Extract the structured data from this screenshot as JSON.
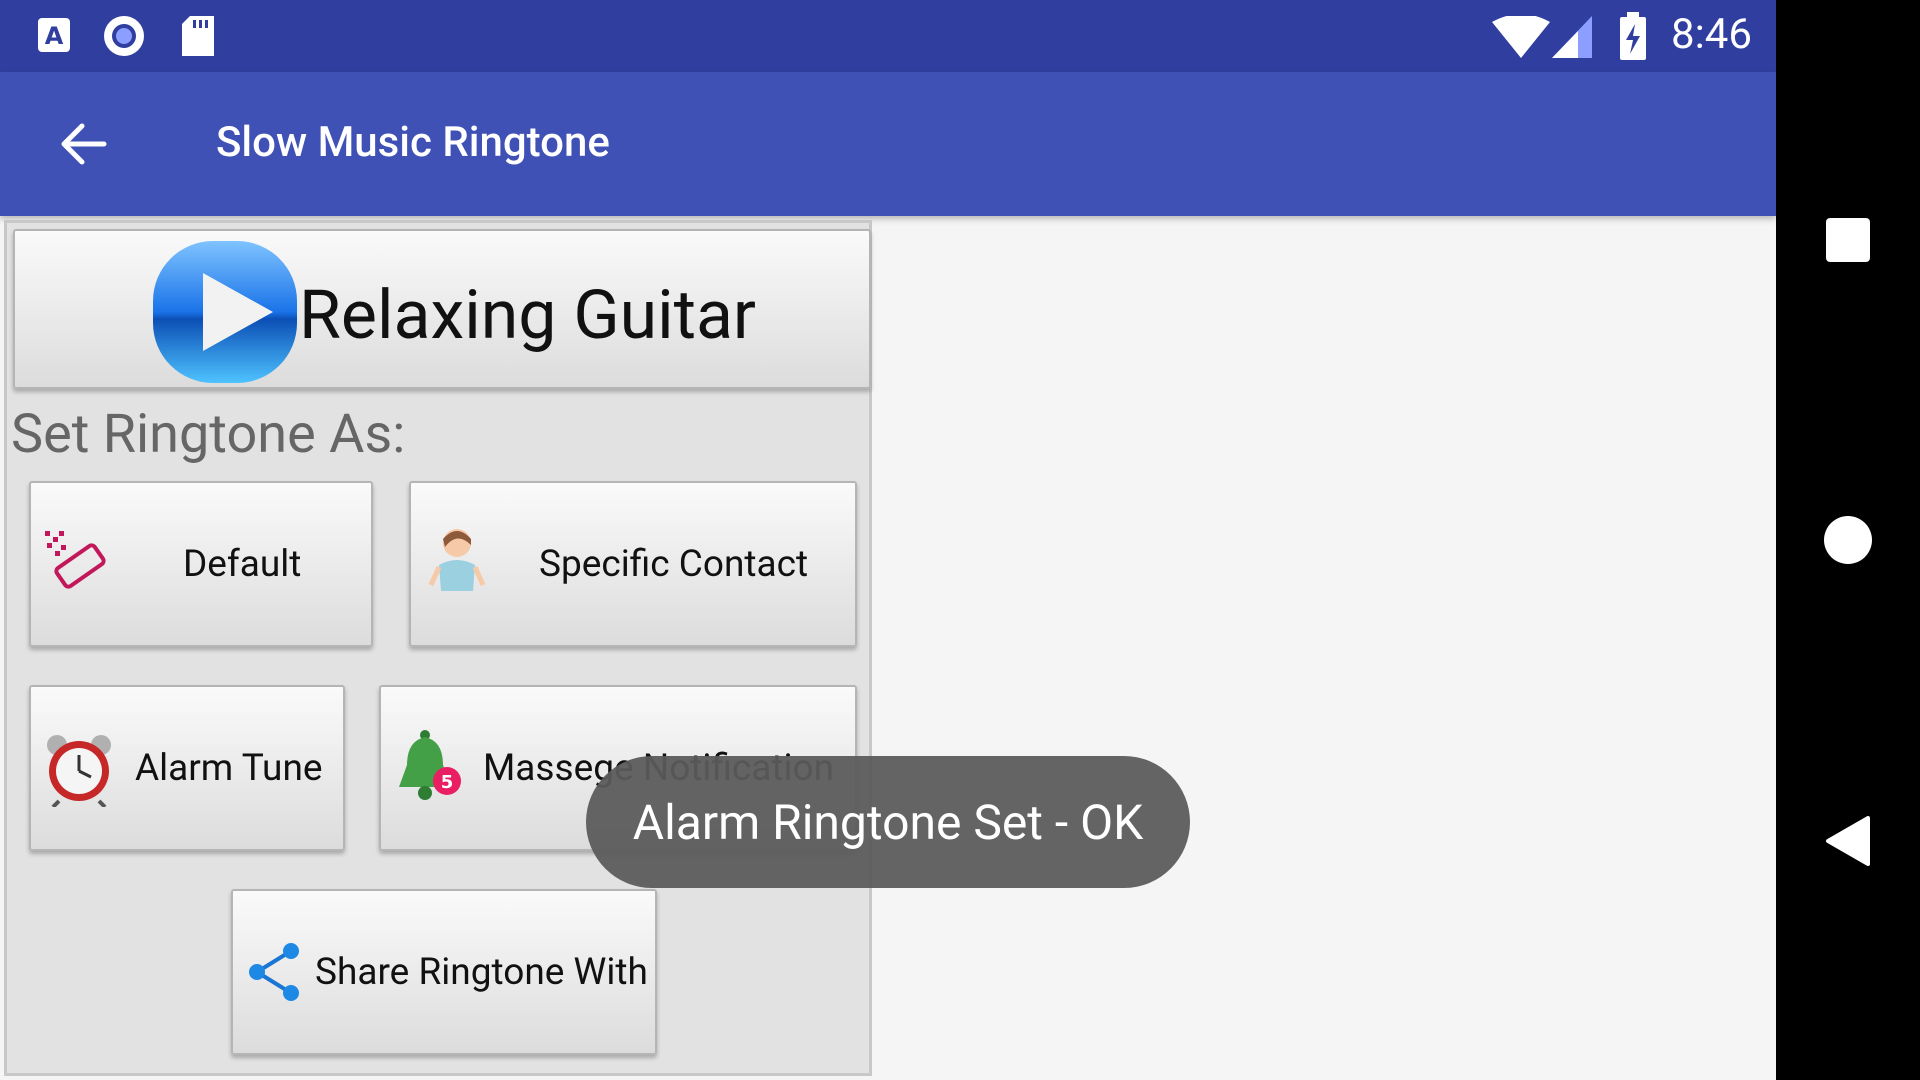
{
  "status_bar": {
    "time": "8:46"
  },
  "app_bar": {
    "title": "Slow Music Ringtone"
  },
  "player": {
    "track_name": "Relaxing Guitar"
  },
  "set_as": {
    "label": "Set Ringtone As:",
    "default_label": "Default",
    "contact_label": "Specific Contact",
    "alarm_label": "Alarm Tune",
    "notification_label": "Massege Notification",
    "share_label": "Share Ringtone With"
  },
  "toast": {
    "message": "Alarm Ringtone Set - OK"
  },
  "colors": {
    "status_bar": "#303f9f",
    "app_bar": "#3f51b5",
    "toast": "#5a5a5a"
  }
}
